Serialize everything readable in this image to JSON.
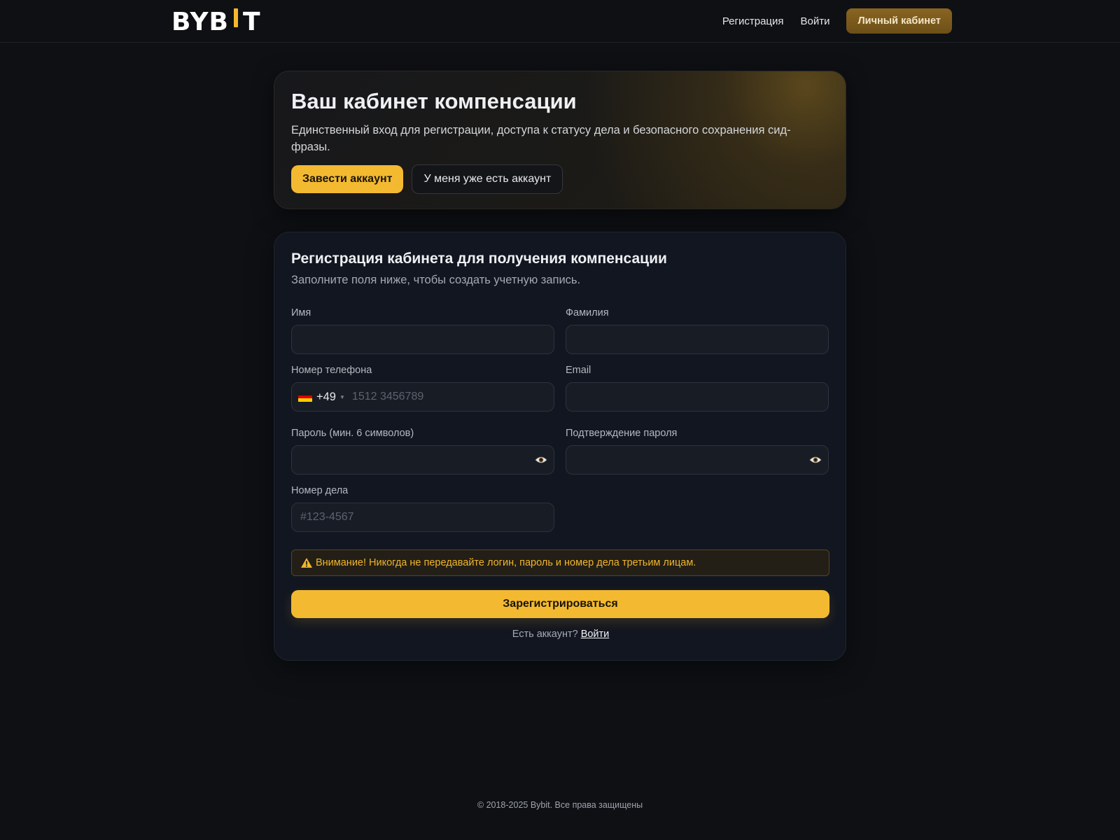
{
  "header": {
    "logo_left": "BYB",
    "logo_right": "T",
    "nav": {
      "register": "Регистрация",
      "login": "Войти",
      "cabinet": "Личный кабинет"
    }
  },
  "hero": {
    "title": "Ваш кабинет компенсации",
    "description": "Единственный вход для регистрации, доступа к статусу дела и безопасного сохранения сид-фразы.",
    "primary_button": "Завести аккаунт",
    "secondary_button": "У меня уже есть аккаунт"
  },
  "registration": {
    "title": "Регистрация кабинета для получения компенсации",
    "subtitle": "Заполните поля ниже, чтобы создать учетную запись.",
    "fields": {
      "first_name": {
        "label": "Имя",
        "value": ""
      },
      "last_name": {
        "label": "Фамилия",
        "value": ""
      },
      "phone": {
        "label": "Номер телефона",
        "country_code": "+49",
        "placeholder": "1512 3456789",
        "value": ""
      },
      "email": {
        "label": "Email",
        "value": ""
      },
      "password": {
        "label": "Пароль (мин. 6 символов)",
        "value": ""
      },
      "password_confirm": {
        "label": "Подтверждение пароля",
        "value": ""
      },
      "case_number": {
        "label": "Номер дела",
        "placeholder": "#123-4567",
        "value": ""
      }
    },
    "warning": "Внимание! Никогда не передавайте логин, пароль и номер дела третьим лицам.",
    "submit": "Зарегистрироваться",
    "have_account": "Есть аккаунт?",
    "login_link": "Войти"
  },
  "footer": {
    "copyright": "© 2018-2025 Bybit. Все права защищены"
  },
  "colors": {
    "accent": "#f3b931",
    "background": "#0e1014",
    "card": "#121620",
    "warning_text": "#f1b52a"
  },
  "icons": [
    "eye-icon",
    "warning-icon",
    "germany-flag-icon",
    "caret-down-icon"
  ]
}
